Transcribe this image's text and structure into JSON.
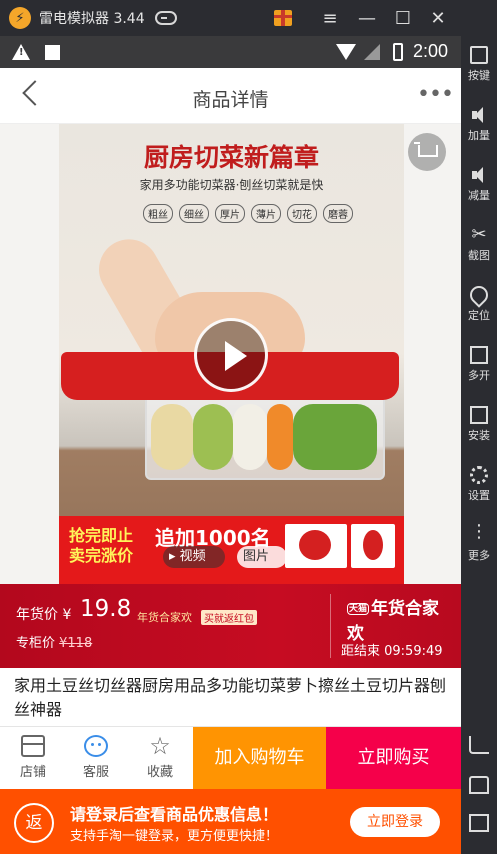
{
  "emulator": {
    "title": "雷电模拟器 3.44",
    "controls": [
      "≡",
      "—",
      "☐",
      "✕"
    ],
    "sidebar": [
      {
        "label": "按键",
        "icon": "keyboard-icon"
      },
      {
        "label": "加量",
        "icon": "volume-up-icon"
      },
      {
        "label": "减量",
        "icon": "volume-down-icon"
      },
      {
        "label": "截图",
        "icon": "scissors-icon"
      },
      {
        "label": "定位",
        "icon": "location-pin-icon"
      },
      {
        "label": "多开",
        "icon": "multi-instance-icon"
      },
      {
        "label": "安装",
        "icon": "apk-install-icon"
      },
      {
        "label": "设置",
        "icon": "gear-icon"
      },
      {
        "label": "更多",
        "icon": "more-dots-icon"
      }
    ]
  },
  "status_bar": {
    "time": "2:00"
  },
  "header": {
    "title": "商品详情"
  },
  "product_image": {
    "headline": "厨房切菜新篇章",
    "subhead": "家用多功能切菜器·刨丝切菜就是快",
    "tags": [
      "粗丝",
      "细丝",
      "厚片",
      "薄片",
      "切花",
      "磨蓉"
    ],
    "banner_left_1": "抢完即止",
    "banner_left_2": "卖完涨价",
    "banner_mid": "追加1000名",
    "media_tab_video": "视频",
    "media_tab_photo": "图片"
  },
  "price": {
    "label": "年货价 ¥",
    "value": "19.8",
    "event": "年货合家欢",
    "badge": "买就返红包",
    "counter_label": "专柜价 ",
    "counter_value": "¥118",
    "logo_small": "天猫",
    "logo_text": "年货合家欢",
    "countdown": "距结束 09:59:49"
  },
  "product": {
    "title": "家用土豆丝切丝器厨房用品多功能切菜萝卜擦丝土豆切片器刨丝神器"
  },
  "actions": {
    "store": "店铺",
    "service": "客服",
    "favorite": "收藏",
    "add_to_cart": "加入购物车",
    "buy_now": "立即购买"
  },
  "promo": {
    "icon_text": "返",
    "line1": "请登录后查看商品优惠信息！",
    "line2": "支持手淘一键登录，更方便更快捷！",
    "button": "立即登录"
  }
}
